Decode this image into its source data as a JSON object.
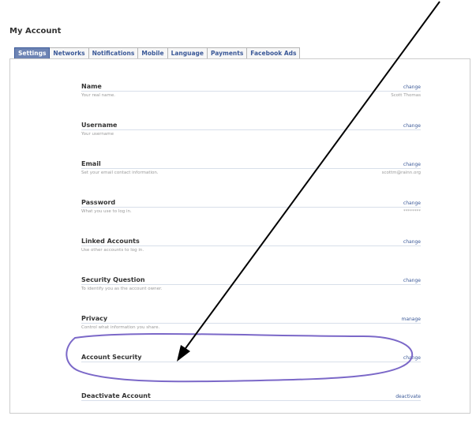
{
  "page": {
    "title": "My Account"
  },
  "tabs": [
    {
      "label": "Settings",
      "active": true
    },
    {
      "label": "Networks"
    },
    {
      "label": "Notifications"
    },
    {
      "label": "Mobile"
    },
    {
      "label": "Language"
    },
    {
      "label": "Payments"
    },
    {
      "label": "Facebook Ads"
    }
  ],
  "rows": [
    {
      "label": "Name",
      "action": "change",
      "description": "Your real name.",
      "value": "Scott Thomas"
    },
    {
      "label": "Username",
      "action": "change",
      "description": "Your username",
      "value": ""
    },
    {
      "label": "Email",
      "action": "change",
      "description": "Set your email contact information.",
      "value": "scottm@rainn.org"
    },
    {
      "label": "Password",
      "action": "change",
      "description": "What you use to log in.",
      "value": "********"
    },
    {
      "label": "Linked Accounts",
      "action": "change",
      "description": "Use other accounts to log in.",
      "value": ""
    },
    {
      "label": "Security Question",
      "action": "change",
      "description": "To identify you as the account owner.",
      "value": ""
    },
    {
      "label": "Privacy",
      "action": "manage",
      "description": "Control what information you share.",
      "value": ""
    },
    {
      "label": "Account Security",
      "action": "change",
      "description": "",
      "value": ""
    },
    {
      "label": "Deactivate Account",
      "action": "deactivate",
      "description": "",
      "value": ""
    }
  ],
  "annotation": {
    "color": "#7b68c8",
    "arrow_color": "#000000"
  }
}
